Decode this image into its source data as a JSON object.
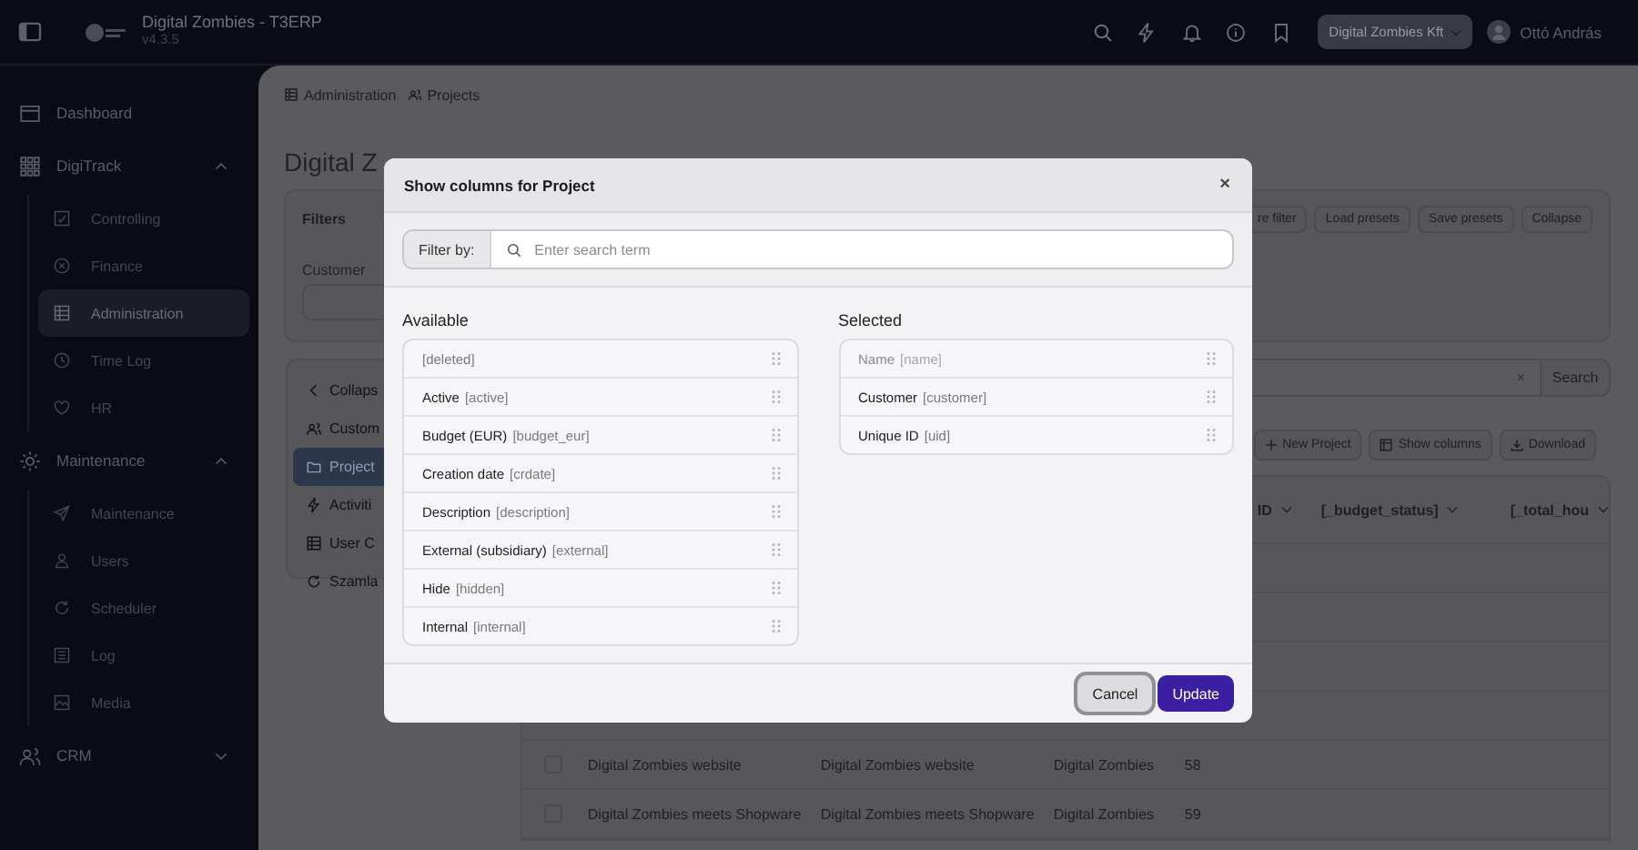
{
  "topbar": {
    "title": "Digital Zombies - T3ERP",
    "version": "v4.3.5",
    "company": "Digital Zombies Kft",
    "user": "Ottó András"
  },
  "sidebar": {
    "items": [
      {
        "label": "Dashboard",
        "selected": false
      },
      {
        "label": "DigiTrack",
        "expanded": true,
        "children": [
          {
            "label": "Controlling",
            "selected": false
          },
          {
            "label": "Finance",
            "selected": false
          },
          {
            "label": "Administration",
            "selected": true
          },
          {
            "label": "Time Log",
            "selected": false
          },
          {
            "label": "HR",
            "selected": false
          }
        ]
      },
      {
        "label": "Maintenance",
        "expanded": true,
        "children": [
          {
            "label": "Maintenance",
            "selected": false
          },
          {
            "label": "Users",
            "selected": false
          },
          {
            "label": "Scheduler",
            "selected": false
          },
          {
            "label": "Log",
            "selected": false
          },
          {
            "label": "Media",
            "selected": false
          }
        ]
      },
      {
        "label": "CRM",
        "expanded": false
      }
    ]
  },
  "breadcrumb": [
    "Administration",
    "Projects"
  ],
  "heading": "Digital Z",
  "filters": {
    "title": "Filters",
    "field_label": "Customer",
    "buttons": [
      "re filter",
      "Load presets",
      "Save presets",
      "Collapse"
    ]
  },
  "subnav": {
    "items": [
      {
        "label": "Collaps",
        "selected": false
      },
      {
        "label": "Custom",
        "selected": false
      },
      {
        "label": "Project",
        "selected": true
      },
      {
        "label": "Activiti",
        "selected": false
      },
      {
        "label": "User C",
        "selected": false
      },
      {
        "label": "Szamla",
        "selected": false
      }
    ]
  },
  "search": {
    "clear": "×",
    "button": "Search"
  },
  "toolbar": [
    "New Project",
    "Show columns",
    "Download"
  ],
  "table": {
    "columns": [
      "ID",
      "[_budget_status]",
      "[_total_hou"
    ],
    "rows": [
      {
        "selected": false,
        "cells": [
          "Digital Zombies website",
          "Digital Zombies website",
          "Digital Zombies",
          "58"
        ]
      },
      {
        "selected": false,
        "cells": [
          "Digital Zombies meets Shopware",
          "Digital Zombies meets Shopware",
          "Digital Zombies",
          "59"
        ]
      }
    ]
  },
  "modal": {
    "title": "Show columns for Project",
    "close": "×",
    "filter_label": "Filter by:",
    "placeholder": "Enter search term",
    "available_title": "Available",
    "selected_title": "Selected",
    "available": [
      {
        "key": "[deleted]",
        "disabled": false
      },
      {
        "label": "Active",
        "key": "[active]",
        "disabled": false
      },
      {
        "label": "Budget (EUR)",
        "key": "[budget_eur]",
        "disabled": false
      },
      {
        "label": "Creation date",
        "key": "[crdate]",
        "disabled": false
      },
      {
        "label": "Description",
        "key": "[description]",
        "disabled": false
      },
      {
        "label": "External (subsidiary)",
        "key": "[external]",
        "disabled": false
      },
      {
        "label": "Hide",
        "key": "[hidden]",
        "disabled": false
      },
      {
        "label": "Internal",
        "key": "[internal]",
        "disabled": false
      }
    ],
    "selected": [
      {
        "label": "Name",
        "key": "[name]",
        "disabled": true
      },
      {
        "label": "Customer",
        "key": "[customer]",
        "disabled": false
      },
      {
        "label": "Unique ID",
        "key": "[uid]",
        "disabled": false
      }
    ],
    "buttons": [
      {
        "label": "Cancel",
        "kind": "secondary",
        "focused": true
      },
      {
        "label": "Update",
        "kind": "primary",
        "focused": false
      }
    ]
  }
}
